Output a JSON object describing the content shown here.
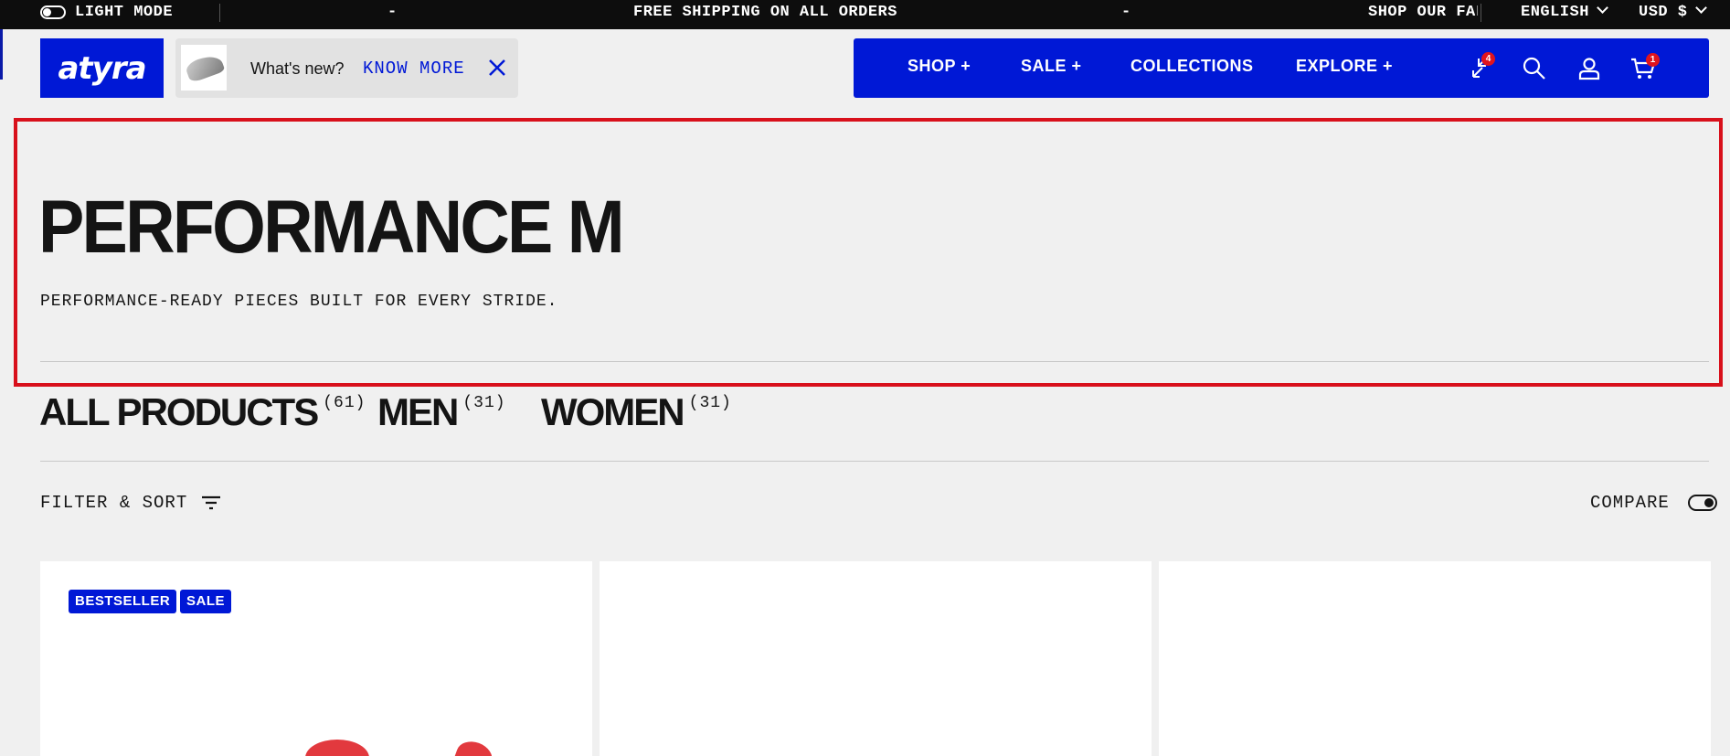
{
  "topbar": {
    "mode_label": "LIGHT MODE",
    "dash_left": "-",
    "announcement": "FREE SHIPPING ON ALL ORDERS",
    "dash_right": "-",
    "promo": "SHOP OUR FAL",
    "language": "ENGLISH",
    "currency": "USD $"
  },
  "brand": {
    "logo_text": "atyra"
  },
  "news": {
    "label": "What's new?",
    "link": "KNOW MORE"
  },
  "nav": {
    "shop": "SHOP +",
    "sale": "SALE +",
    "collections": "COLLECTIONS",
    "explore": "EXPLORE +",
    "compare_count": "4",
    "cart_count": "1"
  },
  "hero": {
    "title": "PERFORMANCE M",
    "subtitle": "PERFORMANCE-READY PIECES BUILT FOR EVERY STRIDE."
  },
  "tabs": [
    {
      "label": "ALL PRODUCTS",
      "count": "(61)"
    },
    {
      "label": "MEN",
      "count": "(31)"
    },
    {
      "label": "WOMEN",
      "count": "(31)"
    }
  ],
  "toolbar": {
    "filter_label": "FILTER & SORT",
    "compare_label": "COMPARE"
  },
  "products": [
    {
      "badges": [
        "BESTSELLER",
        "SALE"
      ]
    },
    {
      "badges": []
    },
    {
      "badges": []
    }
  ],
  "colors": {
    "brand_blue": "#0018d6",
    "badge_red": "#e0141e",
    "highlight_red": "#d8101b"
  }
}
